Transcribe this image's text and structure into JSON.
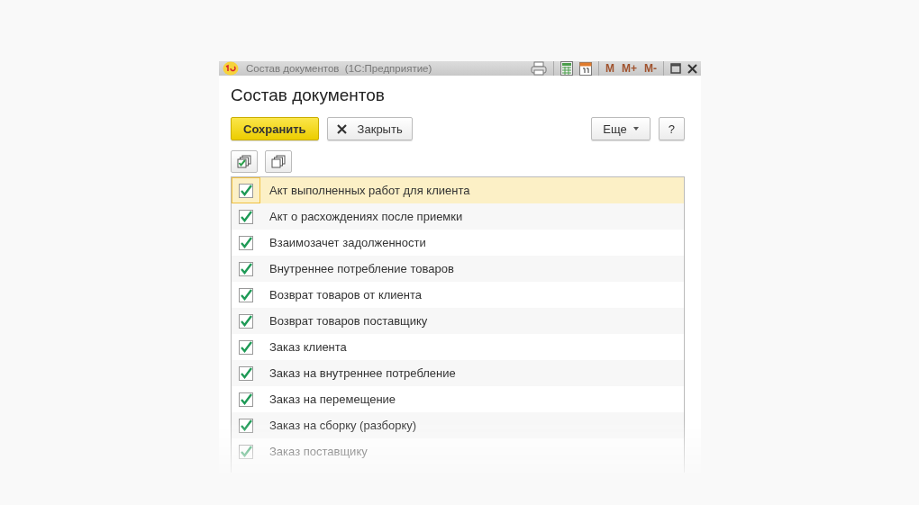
{
  "window": {
    "title": "Состав документов  (1С:Предприятие)",
    "title_buttons": [
      "M",
      "M+",
      "M-"
    ]
  },
  "heading": "Состав документов",
  "buttons": {
    "save": "Сохранить",
    "close": "Закрыть",
    "more": "Еще",
    "help": "?"
  },
  "rows": [
    {
      "label": "Акт выполненных работ для клиента",
      "checked": true,
      "selected": true
    },
    {
      "label": "Акт о расхождениях после приемки",
      "checked": true,
      "selected": false
    },
    {
      "label": "Взаимозачет задолженности",
      "checked": true,
      "selected": false
    },
    {
      "label": "Внутреннее потребление товаров",
      "checked": true,
      "selected": false
    },
    {
      "label": "Возврат товаров от клиента",
      "checked": true,
      "selected": false
    },
    {
      "label": "Возврат товаров поставщику",
      "checked": true,
      "selected": false
    },
    {
      "label": "Заказ клиента",
      "checked": true,
      "selected": false
    },
    {
      "label": "Заказ на внутреннее потребление",
      "checked": true,
      "selected": false
    },
    {
      "label": "Заказ на перемещение",
      "checked": true,
      "selected": false
    },
    {
      "label": "Заказ на сборку (разборку)",
      "checked": true,
      "selected": false
    },
    {
      "label": "Заказ поставщику",
      "checked": true,
      "selected": false
    }
  ]
}
